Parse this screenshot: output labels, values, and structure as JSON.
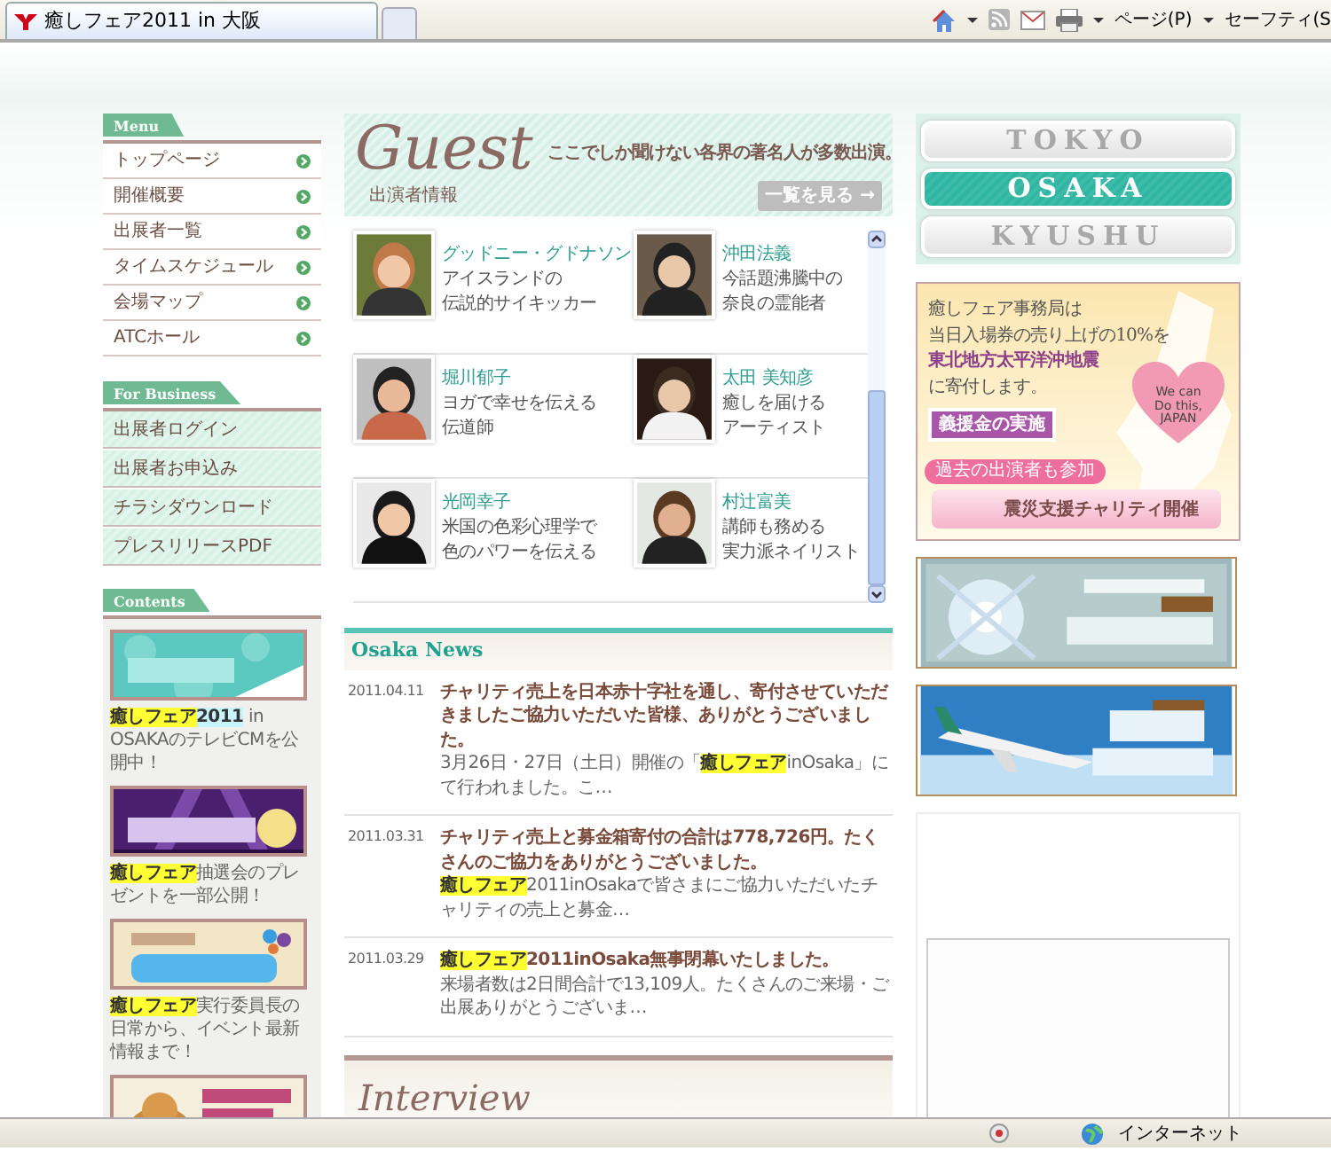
{
  "browser": {
    "tab": {
      "title": "癒しフェア2011 in 大阪"
    },
    "toolbar": [
      {
        "kind": "home"
      },
      {
        "kind": "feeds"
      },
      {
        "kind": "mail"
      },
      {
        "kind": "print"
      },
      {
        "kind": "menu",
        "label": "ページ(P)"
      },
      {
        "kind": "menu",
        "label": "セーフティ(S"
      }
    ]
  },
  "menu": {
    "title": "Menu",
    "items": [
      "トップページ",
      "開催概要",
      "出展者一覧",
      "タイムスケジュール",
      "会場マップ",
      "ATCホール"
    ]
  },
  "business": {
    "title": "For Business",
    "items": [
      "出展者ログイン",
      "出展者お申込み",
      "チラシダウンロード",
      "プレスリリースPDF"
    ]
  },
  "contents": {
    "title": "Contents",
    "items": [
      {
        "kind": "banner",
        "parts": [
          {
            "text": "癒しフェア",
            "color": "#ffff33"
          },
          {
            "text": "2011",
            "color": "#c8f4ff"
          },
          {
            "text": " in OSAKAのテレビCMを公開中！"
          }
        ]
      },
      {
        "kind": "banner",
        "parts": [
          {
            "text": "癒しフェア",
            "color": "#ffff33"
          },
          {
            "text": "抽選会のプレゼントを一部公開！"
          }
        ]
      },
      {
        "kind": "banner",
        "parts": [
          {
            "text": "癒しフェア",
            "color": "#ffff33"
          },
          {
            "text": "実行委員長の日常から、イベント最新情報まで！"
          }
        ]
      },
      {
        "kind": "picture"
      }
    ]
  },
  "guest": {
    "title": "Guest",
    "tagline": "ここでしか聞けない各界の著名人が多数出演。",
    "subtitle": "出演者情報",
    "more_button": "一覧を見る →",
    "guests": [
      {
        "name": "グッドニー・グドナソン",
        "lines": [
          "アイスランドの",
          "伝説的サイキッカー"
        ]
      },
      {
        "name": "沖田法義",
        "lines": [
          "今話題沸騰中の",
          "奈良の霊能者"
        ]
      },
      {
        "name": "堀川郁子",
        "lines": [
          "ヨガで幸せを伝える",
          "伝道師"
        ]
      },
      {
        "name": "太田 美知彦",
        "lines": [
          "癒しを届ける",
          "アーティスト"
        ]
      },
      {
        "name": "光岡幸子",
        "lines": [
          "米国の色彩心理学で",
          "色のパワーを伝える"
        ]
      },
      {
        "name": "村辻富美",
        "lines": [
          "講師も務める",
          "実力派ネイリスト"
        ]
      }
    ]
  },
  "news": {
    "title": "Osaka News",
    "items": [
      {
        "date": "2011.04.11",
        "title": [
          {
            "text": "チャリティ売上を日本赤十字社を通し、寄付させていただきましたご協力いただいた皆様、ありがとうございました。"
          }
        ],
        "body": [
          {
            "text": "3月26日・27日（土日）開催の「"
          },
          {
            "text": "癒しフェア",
            "color": "#ffff33"
          },
          {
            "text": "inOsaka」にて行われました。こ…"
          }
        ]
      },
      {
        "date": "2011.03.31",
        "title": [
          {
            "text": "チャリティ売上と募金箱寄付の合計は778,726円。たくさんのご協力をありがとうございました。"
          }
        ],
        "body": [
          {
            "text": "癒しフェア",
            "color": "#ffff33"
          },
          {
            "text": "2011inOsakaで皆さまにご協力いただいたチャリティの売上と募金…"
          }
        ]
      },
      {
        "date": "2011.03.29",
        "title": [
          {
            "text": "癒しフェア",
            "color": "#ffff33"
          },
          {
            "text": "2011inOsaka無事閉幕いたしました。"
          }
        ],
        "body": [
          {
            "text": "来場者数は2日間合計で13,109人。たくさんのご来場・ご出展ありがとうございま…"
          }
        ]
      }
    ]
  },
  "interview": {
    "title": "Interview"
  },
  "cities": [
    {
      "label": "TOKYO",
      "selected": false
    },
    {
      "label": "OSAKA",
      "selected": true
    },
    {
      "label": "KYUSHU",
      "selected": false
    }
  ],
  "charity": {
    "lines": [
      {
        "text": "癒しフェア事務局は",
        "kind": "plain"
      },
      {
        "text": "当日入場券の売り上げの10%を",
        "kind": "plain"
      },
      {
        "text": "東北地方太平洋沖地震",
        "kind": "emphasis"
      },
      {
        "text": "に寄付します。",
        "kind": "plain"
      }
    ],
    "heart": [
      "We can",
      "Do this,",
      "JAPAN"
    ],
    "donation_button": "義援金の実施",
    "badge": "過去の出演者も参加",
    "event_button": "震災支援チャリティ開催"
  },
  "status_bar": {
    "zone": "インターネット"
  }
}
